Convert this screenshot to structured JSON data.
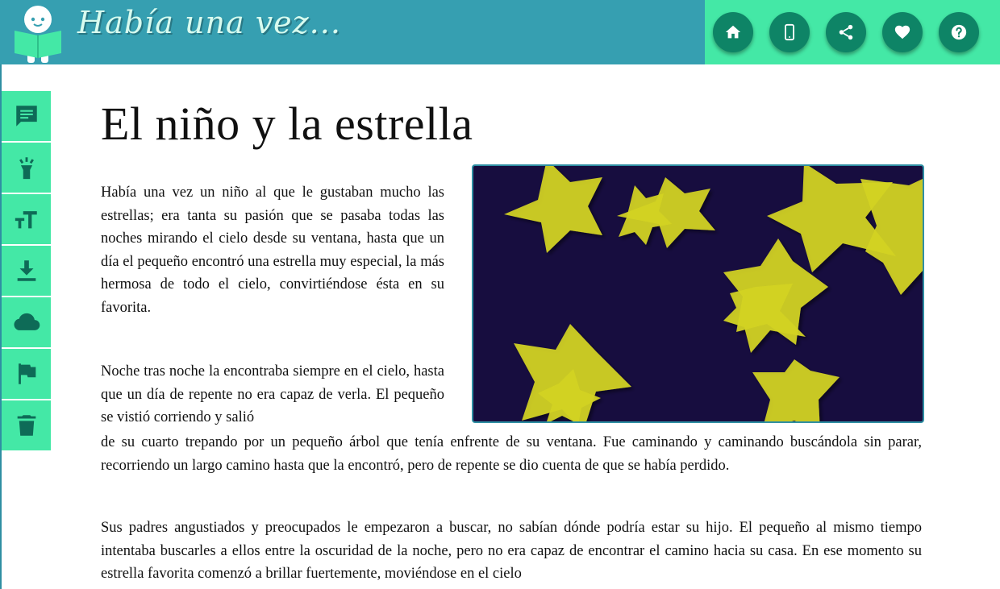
{
  "header": {
    "brand_title": "Había una vez...",
    "actions": [
      {
        "name": "home-button",
        "icon": "home-icon"
      },
      {
        "name": "mobile-button",
        "icon": "mobile-icon"
      },
      {
        "name": "share-button",
        "icon": "share-icon"
      },
      {
        "name": "favorite-button",
        "icon": "heart-icon"
      },
      {
        "name": "help-button",
        "icon": "help-icon"
      }
    ]
  },
  "sidebar": {
    "items": [
      {
        "name": "comments-button",
        "icon": "comment-icon"
      },
      {
        "name": "highlight-button",
        "icon": "flashlight-icon"
      },
      {
        "name": "text-size-button",
        "icon": "text-size-icon"
      },
      {
        "name": "download-button",
        "icon": "download-icon"
      },
      {
        "name": "cloud-button",
        "icon": "cloud-icon"
      },
      {
        "name": "report-button",
        "icon": "flag-icon"
      },
      {
        "name": "delete-button",
        "icon": "trash-icon"
      }
    ]
  },
  "story": {
    "title": "El niño y la estrella",
    "p1": "Había una vez un niño al que le gustaban mucho las estrellas; era tanta su pasión que se pasaba todas las noches mirando el cielo desde su ventana, hasta que un día el pequeño encontró una estrella muy especial, la más hermosa de todo el cielo, convirtiéndose ésta en su favorita.",
    "p2_part1": "Noche tras noche la encontraba siempre en el cielo, hasta que un día de repente no era capaz de verla. El pequeño se vistió corriendo y salió",
    "p2_part2": "de su cuarto trepando por un pequeño árbol que tenía enfrente de su ventana. Fue caminando y caminando buscándola sin parar, recorriendo un largo camino hasta que la encontró, pero de repente se dio cuenta de que se había perdido.",
    "p3": "Sus padres angustiados y preocupados le empezaron a buscar, no sabían dónde podría estar su hijo. El pequeño al mismo tiempo intentaba buscarles a ellos entre la oscuridad de la noche, pero no era capaz de encontrar el camino hacia su casa. En ese momento su estrella favorita comenzó a brillar fuertemente, moviéndose en el cielo"
  },
  "colors": {
    "brand_bar": "#369fb1",
    "accent": "#44e8a6",
    "button": "#0e8466",
    "night_sky": "#170d3f",
    "star": "#d4d422"
  }
}
